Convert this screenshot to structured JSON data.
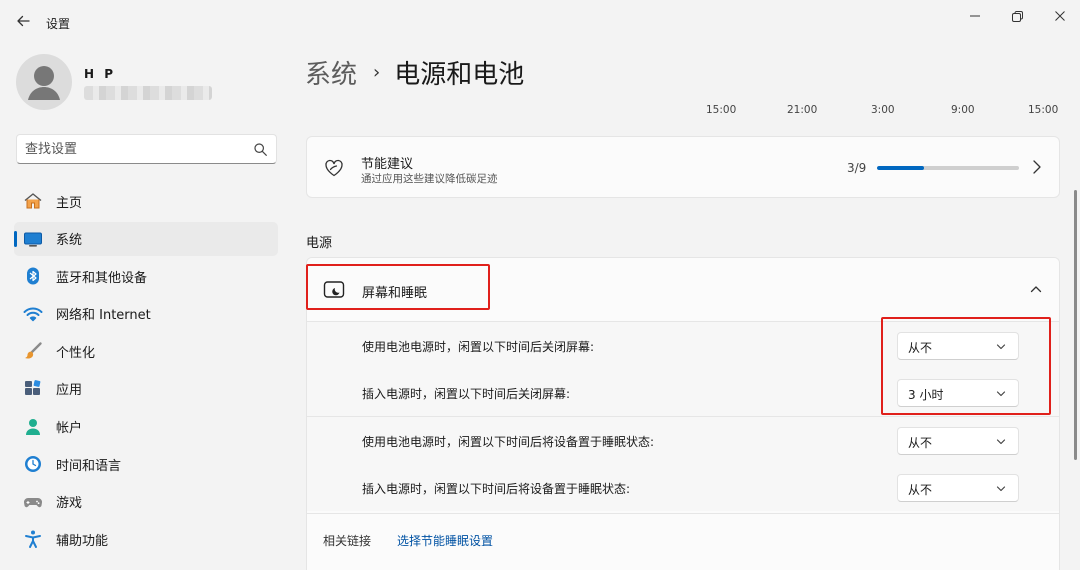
{
  "window": {
    "title": "设置",
    "back_icon": "arrow-left-icon",
    "controls": [
      "minimize-icon",
      "restore-icon",
      "close-icon"
    ]
  },
  "user": {
    "name": "H P",
    "email": ""
  },
  "search": {
    "placeholder": "查找设置",
    "icon": "search-icon"
  },
  "sidebar": {
    "items": [
      {
        "label": "主页",
        "icon": "home-icon",
        "active": false
      },
      {
        "label": "系统",
        "icon": "system-monitor-icon",
        "active": true
      },
      {
        "label": "蓝牙和其他设备",
        "icon": "bluetooth-icon",
        "active": false
      },
      {
        "label": "网络和 Internet",
        "icon": "wifi-icon",
        "active": false
      },
      {
        "label": "个性化",
        "icon": "brush-icon",
        "active": false
      },
      {
        "label": "应用",
        "icon": "apps-icon",
        "active": false
      },
      {
        "label": "帐户",
        "icon": "account-icon",
        "active": false
      },
      {
        "label": "时间和语言",
        "icon": "clock-globe-icon",
        "active": false
      },
      {
        "label": "游戏",
        "icon": "gamepad-icon",
        "active": false
      },
      {
        "label": "辅助功能",
        "icon": "accessibility-icon",
        "active": false
      }
    ]
  },
  "breadcrumb": {
    "parent": "系统",
    "separator": "›",
    "current": "电源和电池"
  },
  "time_axis": [
    "15:00",
    "21:00",
    "3:00",
    "9:00",
    "15:00"
  ],
  "eco": {
    "title": "节能建议",
    "subtitle": "通过应用这些建议降低碳足迹",
    "count": "3/9",
    "progress_fraction": 0.333
  },
  "power": {
    "heading": "电源",
    "screen_sleep": {
      "title": "屏幕和睡眠",
      "rows": [
        {
          "label": "使用电池电源时，闲置以下时间后关闭屏幕:",
          "value": "从不"
        },
        {
          "label": "插入电源时，闲置以下时间后关闭屏幕:",
          "value": "3 小时"
        },
        {
          "label": "使用电池电源时，闲置以下时间后将设备置于睡眠状态:",
          "value": "从不"
        },
        {
          "label": "插入电源时，闲置以下时间后将设备置于睡眠状态:",
          "value": "从不"
        }
      ]
    },
    "related": {
      "label": "相关链接",
      "link": "选择节能睡眠设置"
    }
  },
  "colors": {
    "accent": "#0067c0",
    "highlight": "#e0201b",
    "background": "#f3f3f3"
  }
}
